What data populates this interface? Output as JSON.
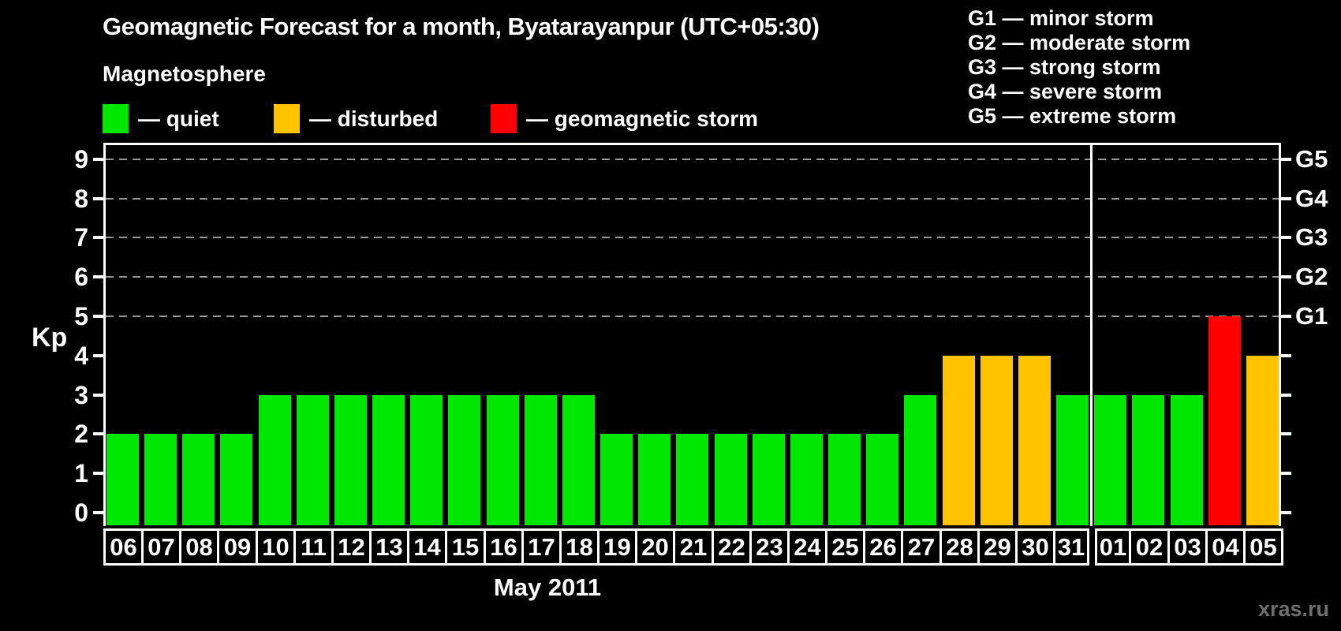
{
  "header": {
    "title": "Geomagnetic Forecast for a month, Byatarayanpur (UTC+05:30)",
    "subtitle": "Magnetosphere"
  },
  "legend": {
    "items": [
      {
        "name": "quiet",
        "label": "— quiet",
        "color": "#00E800"
      },
      {
        "name": "disturbed",
        "label": "— disturbed",
        "color": "#FFC300"
      },
      {
        "name": "storm",
        "label": "— geomagnetic storm",
        "color": "#FF0000"
      }
    ]
  },
  "storm_scale": {
    "items": [
      "G1 — minor storm",
      "G2 — moderate storm",
      "G3 — strong storm",
      "G4 — severe storm",
      "G5 — extreme storm"
    ]
  },
  "chart_data": {
    "type": "bar",
    "title": "Geomagnetic Forecast for a month, Byatarayanpur (UTC+05:30)",
    "subtitle": "Magnetosphere",
    "xlabel": "May 2011",
    "ylabel": "Kp",
    "ylim": [
      0,
      9.4
    ],
    "grid": "dashed horizontal at Kp 5-9 only",
    "legend_position": "top-left",
    "y_ticks": [
      0,
      1,
      2,
      3,
      4,
      5,
      6,
      7,
      8,
      9
    ],
    "gridlines_at_kp": [
      5,
      6,
      7,
      8,
      9
    ],
    "right_axis_labels": [
      {
        "label": "G1",
        "kp": 5
      },
      {
        "label": "G2",
        "kp": 6
      },
      {
        "label": "G3",
        "kp": 7
      },
      {
        "label": "G4",
        "kp": 8
      },
      {
        "label": "G5",
        "kp": 9
      }
    ],
    "categories": [
      "06",
      "07",
      "08",
      "09",
      "10",
      "11",
      "12",
      "13",
      "14",
      "15",
      "16",
      "17",
      "18",
      "19",
      "20",
      "21",
      "22",
      "23",
      "24",
      "25",
      "26",
      "27",
      "28",
      "29",
      "30",
      "31",
      "01",
      "02",
      "03",
      "04",
      "05"
    ],
    "values": [
      2,
      2,
      2,
      2,
      3,
      3,
      3,
      3,
      3,
      3,
      3,
      3,
      3,
      2,
      2,
      2,
      2,
      2,
      2,
      2,
      2,
      3,
      4,
      4,
      4,
      3,
      3,
      3,
      3,
      5,
      4
    ],
    "month_separator_after_index": 25,
    "state_thresholds": {
      "quiet_max": 3,
      "disturbed": 4,
      "storm_min": 5
    },
    "colors": {
      "quiet": "#00E800",
      "disturbed": "#FFC300",
      "storm": "#FF0000"
    }
  },
  "footer": {
    "month_label": "May 2011",
    "watermark": "xras.ru"
  }
}
